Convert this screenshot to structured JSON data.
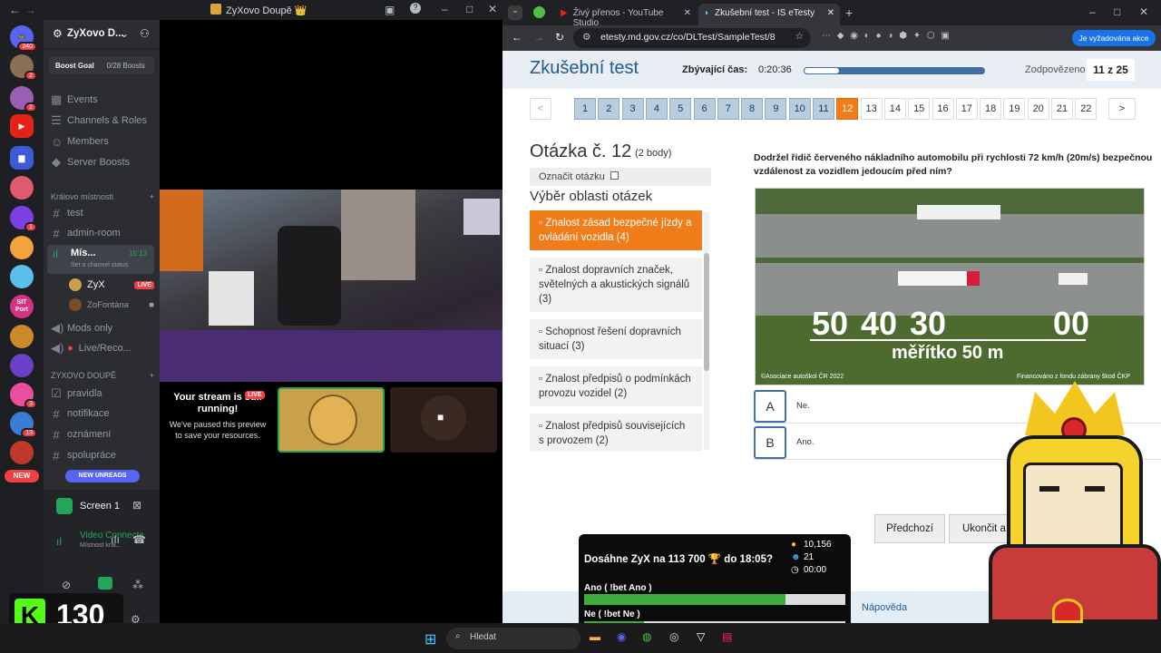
{
  "discord": {
    "window_title": "ZyXovo Doupě 👑",
    "server_name": "ZyXovo D...",
    "boost_goal": "Boost Goal",
    "boosts": "0/28 Boosts",
    "unread_count": "240",
    "nav": [
      "Events",
      "Channels & Roles",
      "Members",
      "Server Boosts"
    ],
    "category1": "Královo místnosti",
    "ch_test": "test",
    "ch_admin": "admin-room",
    "voice_name": "Mís...",
    "voice_time": "15:13",
    "voice_status": "Set a channel status",
    "user1": "ZyX",
    "live": "LIVE",
    "user2": "ZoFontána",
    "mods": "Mods only",
    "live_rec": "Live/Reco...",
    "category2": "ZYXOVO DOUPĚ",
    "ch_rules": "pravidla",
    "ch_notif": "notifikace",
    "ch_ann": "oznámení",
    "ch_coop": "spolupráce",
    "new_unreads": "NEW UNREADS",
    "new_badge": "NEW",
    "screen": "Screen 1",
    "vc_title": "Video Connected",
    "vc_sub": "Místnost král...",
    "stream_msg_title": "Your stream is still running!",
    "stream_msg_body": "We've paused this preview to save your resources.",
    "server_badges": [
      "2",
      "2",
      "1",
      "3",
      "13"
    ],
    "server_labels": [
      "SIT Port"
    ]
  },
  "browser": {
    "tab1": "Živý přenos - YouTube Studio",
    "tab2": "Zkušební test - IS eTesty",
    "url": "etesty.md.gov.cz/co/DLTest/SampleTest/8",
    "action_btn": "Je vyžadována akce"
  },
  "test": {
    "title": "Zkušební test",
    "time_label": "Zbývající čas:",
    "time": "0:20:36",
    "progress": 0.2,
    "answered_label": "Zodpovězeno",
    "answered": "11 z 25",
    "nav_prev": "<",
    "nav_next": ">",
    "questions": [
      "1",
      "2",
      "3",
      "4",
      "5",
      "6",
      "7",
      "8",
      "9",
      "10",
      "11",
      "12",
      "13",
      "14",
      "15",
      "16",
      "17",
      "18",
      "19",
      "20",
      "21",
      "22"
    ],
    "current": 12,
    "answered_count": 11,
    "question_title": "Otázka č. 12",
    "points": "(2 body)",
    "mark": "Označit otázku",
    "areas_title": "Výběr oblasti otázek",
    "areas": [
      "Znalost zásad bezpečné jízdy a ovládání vozidla (4)",
      "Znalost dopravních značek, světelných a akustických signálů (3)",
      "Schopnost řešení dopravních situací (3)",
      "Znalost předpisů o podmínkách provozu vozidel (2)",
      "Znalost předpisů souvisejících s provozem (2)"
    ],
    "question_text": "Dodržel řidič červeného nákladního automobilu při rychlosti 72 km/h (20m/s) bezpečnou vzdálenost za vozidlem jedoucím před ním?",
    "img_nums": [
      "50",
      "40",
      "30",
      "00"
    ],
    "img_scale": "měřítko 50 m",
    "img_copy": "©Asociace autoškol ČR 2022",
    "img_fund": "Financováno z fondu zábrany škod ČKP",
    "answers": [
      {
        "letter": "A",
        "text": "Ne."
      },
      {
        "letter": "B",
        "text": "Ano."
      }
    ],
    "btn_prev": "Předchozí",
    "btn_finish": "Ukončit a",
    "footer_help": "Nápověda"
  },
  "overlay": {
    "bet_title": "Dosáhne ZyX na 113 700 🏆 do 18:05?",
    "coins": "10,156",
    "people": "21",
    "timer": "00:00",
    "opt1": "Ano ( !bet Ano )",
    "opt1_frac": 0.77,
    "opt2": "Ne ( !bet Ne )",
    "opt2_frac": 0.23,
    "kick_count": "130"
  },
  "taskbar": {
    "search": "Hledat"
  }
}
